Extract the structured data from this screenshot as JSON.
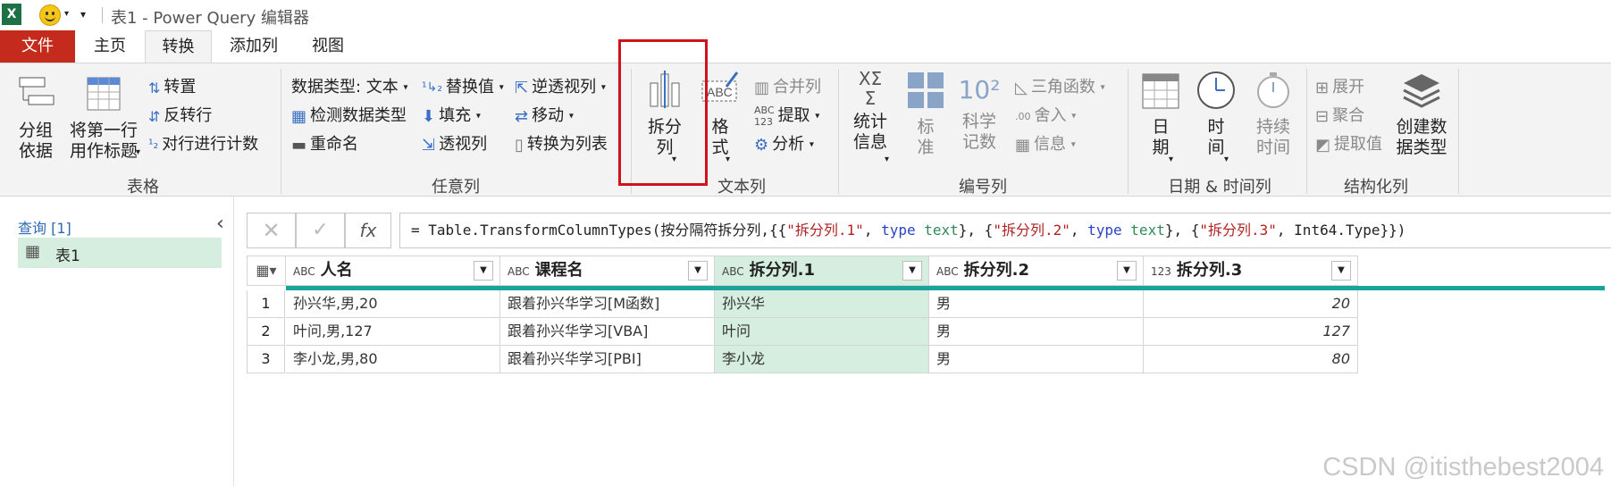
{
  "window": {
    "title": "表1 - Power Query 编辑器"
  },
  "tabs": [
    {
      "label": "文件"
    },
    {
      "label": "主页"
    },
    {
      "label": "转换"
    },
    {
      "label": "添加列"
    },
    {
      "label": "视图"
    }
  ],
  "ribbon": {
    "table_group": {
      "label": "表格",
      "group_by": "分组\n依据",
      "use_first_row": "将第一行\n用作标题",
      "transpose": "转置",
      "reverse_rows": "反转行",
      "count_rows": "对行进行计数"
    },
    "any_column_group": {
      "label": "任意列",
      "data_type": "数据类型: 文本",
      "detect_type": "检测数据类型",
      "rename": "重命名",
      "replace_values": "替换值",
      "fill": "填充",
      "pivot": "透视列",
      "unpivot": "逆透视列",
      "move": "移动",
      "to_list": "转换为列表"
    },
    "text_column_group": {
      "label": "文本列",
      "split_column": "拆分\n列",
      "format": "格\n式",
      "merge_columns": "合并列",
      "extract": "提取",
      "parse": "分析"
    },
    "number_column_group": {
      "label": "编号列",
      "statistics": "统计\n信息",
      "standard": "标\n准",
      "scientific": "科学\n记数",
      "trigonometry": "三角函数",
      "rounding": "舍入",
      "information": "信息"
    },
    "datetime_group": {
      "label": "日期 & 时间列",
      "date": "日\n期",
      "time": "时\n间",
      "duration": "持续\n时间"
    },
    "structured_group": {
      "label": "结构化列",
      "expand": "展开",
      "aggregate": "聚合",
      "extract_values": "提取值",
      "create_data_type": "创建数\n据类型"
    }
  },
  "queries_pane": {
    "header": "查询 [1]",
    "items": [
      {
        "label": "表1"
      }
    ]
  },
  "formula_bar": {
    "fx": "fx",
    "parts": [
      {
        "t": "= Table.TransformColumnTypes(按分隔符拆分列,{{",
        "c": "plain"
      },
      {
        "t": "\"拆分列.1\"",
        "c": "str"
      },
      {
        "t": ", ",
        "c": "plain"
      },
      {
        "t": "type",
        "c": "kw"
      },
      {
        "t": " ",
        "c": "plain"
      },
      {
        "t": "text",
        "c": "cmt"
      },
      {
        "t": "}, {",
        "c": "plain"
      },
      {
        "t": "\"拆分列.2\"",
        "c": "str"
      },
      {
        "t": ", ",
        "c": "plain"
      },
      {
        "t": "type",
        "c": "kw"
      },
      {
        "t": " ",
        "c": "plain"
      },
      {
        "t": "text",
        "c": "cmt"
      },
      {
        "t": "}, {",
        "c": "plain"
      },
      {
        "t": "\"拆分列.3\"",
        "c": "str"
      },
      {
        "t": ", Int64.Type}})",
        "c": "plain"
      }
    ]
  },
  "table": {
    "columns": [
      {
        "type_icon": "ABC",
        "name": "人名"
      },
      {
        "type_icon": "ABC",
        "name": "课程名"
      },
      {
        "type_icon": "ABC",
        "name": "拆分列.1"
      },
      {
        "type_icon": "ABC",
        "name": "拆分列.2"
      },
      {
        "type_icon": "123",
        "name": "拆分列.3"
      }
    ],
    "rows": [
      {
        "n": "1",
        "cells": [
          "孙兴华,男,20",
          "跟着孙兴华学习[M函数]",
          "孙兴华",
          "男",
          "20"
        ]
      },
      {
        "n": "2",
        "cells": [
          "叶问,男,127",
          "跟着孙兴华学习[VBA]",
          "叶问",
          "男",
          "127"
        ]
      },
      {
        "n": "3",
        "cells": [
          "李小龙,男,80",
          "跟着孙兴华学习[PBI]",
          "李小龙",
          "男",
          "80"
        ]
      }
    ]
  },
  "watermark": "CSDN @itisthebest2004",
  "colors": {
    "file_tab": "#c42b1c",
    "selected_column": "#d6eedf",
    "header_bar": "#1aa39a",
    "highlight_box": "#d0121c"
  }
}
